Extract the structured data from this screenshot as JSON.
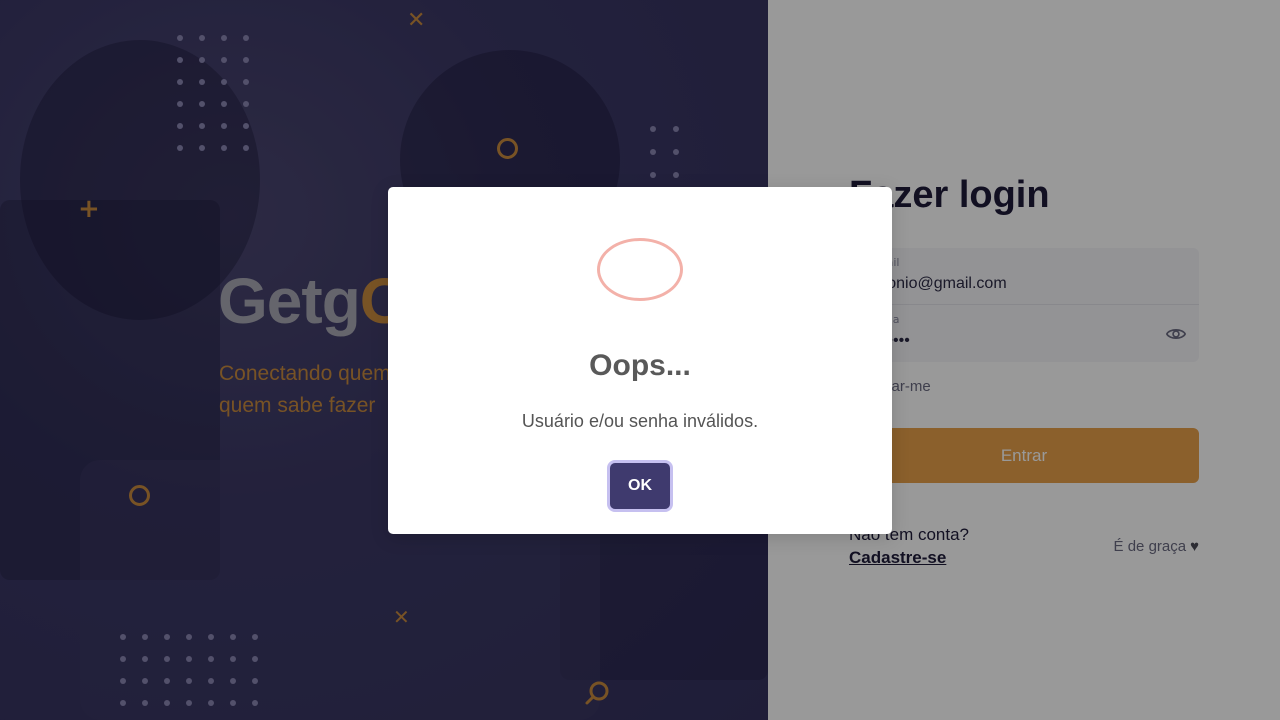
{
  "hero": {
    "brand_main": "Getg",
    "brand_accent": "O",
    "tagline": "Conectando quem precisa com quem sabe fazer",
    "decorations": [
      "x-icon",
      "plus-icon",
      "ring-icon",
      "search-icon"
    ]
  },
  "login": {
    "title": "Fazer login",
    "email_label": "E-mail",
    "email_value": "antonio@gmail.com",
    "password_label": "Senha",
    "password_value": "••••••••",
    "remember_label": "Lembrar-me",
    "submit_label": "Entrar",
    "no_account_text": "Não tem conta?",
    "signup_link": "Cadastre-se",
    "free_text": "É de graça"
  },
  "modal": {
    "title": "Oops...",
    "message": "Usuário e/ou senha inválidos.",
    "ok_label": "OK"
  },
  "colors": {
    "hero_bg": "#34315e",
    "accent_orange": "#e8a14a",
    "modal_button": "#3f3a6e",
    "error_ring": "#f3b1a9"
  }
}
